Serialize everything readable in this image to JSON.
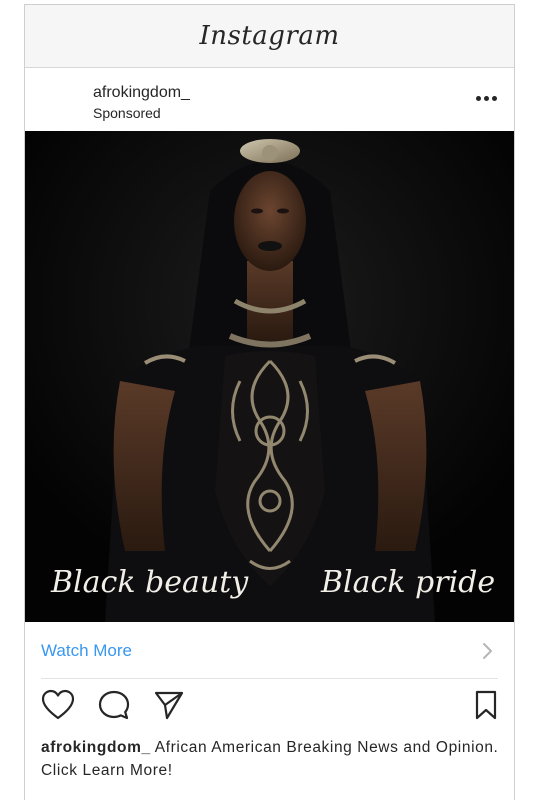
{
  "app": {
    "title": "Instagram"
  },
  "post": {
    "username": "afrokingdom_",
    "sponsored_label": "Sponsored",
    "image": {
      "caption_left": "Black beauty",
      "caption_right": "Black pride"
    },
    "cta_label": "Watch More",
    "caption_username": "afrokingdom_",
    "caption_text": "African American Breaking News and Opinion. Click Learn More!"
  },
  "colors": {
    "link": "#3897f0",
    "text": "#262626"
  },
  "icons": {
    "more": "more-options-icon",
    "like": "heart-icon",
    "comment": "comment-icon",
    "share": "send-icon",
    "save": "bookmark-icon",
    "chevron": "chevron-right-icon"
  }
}
